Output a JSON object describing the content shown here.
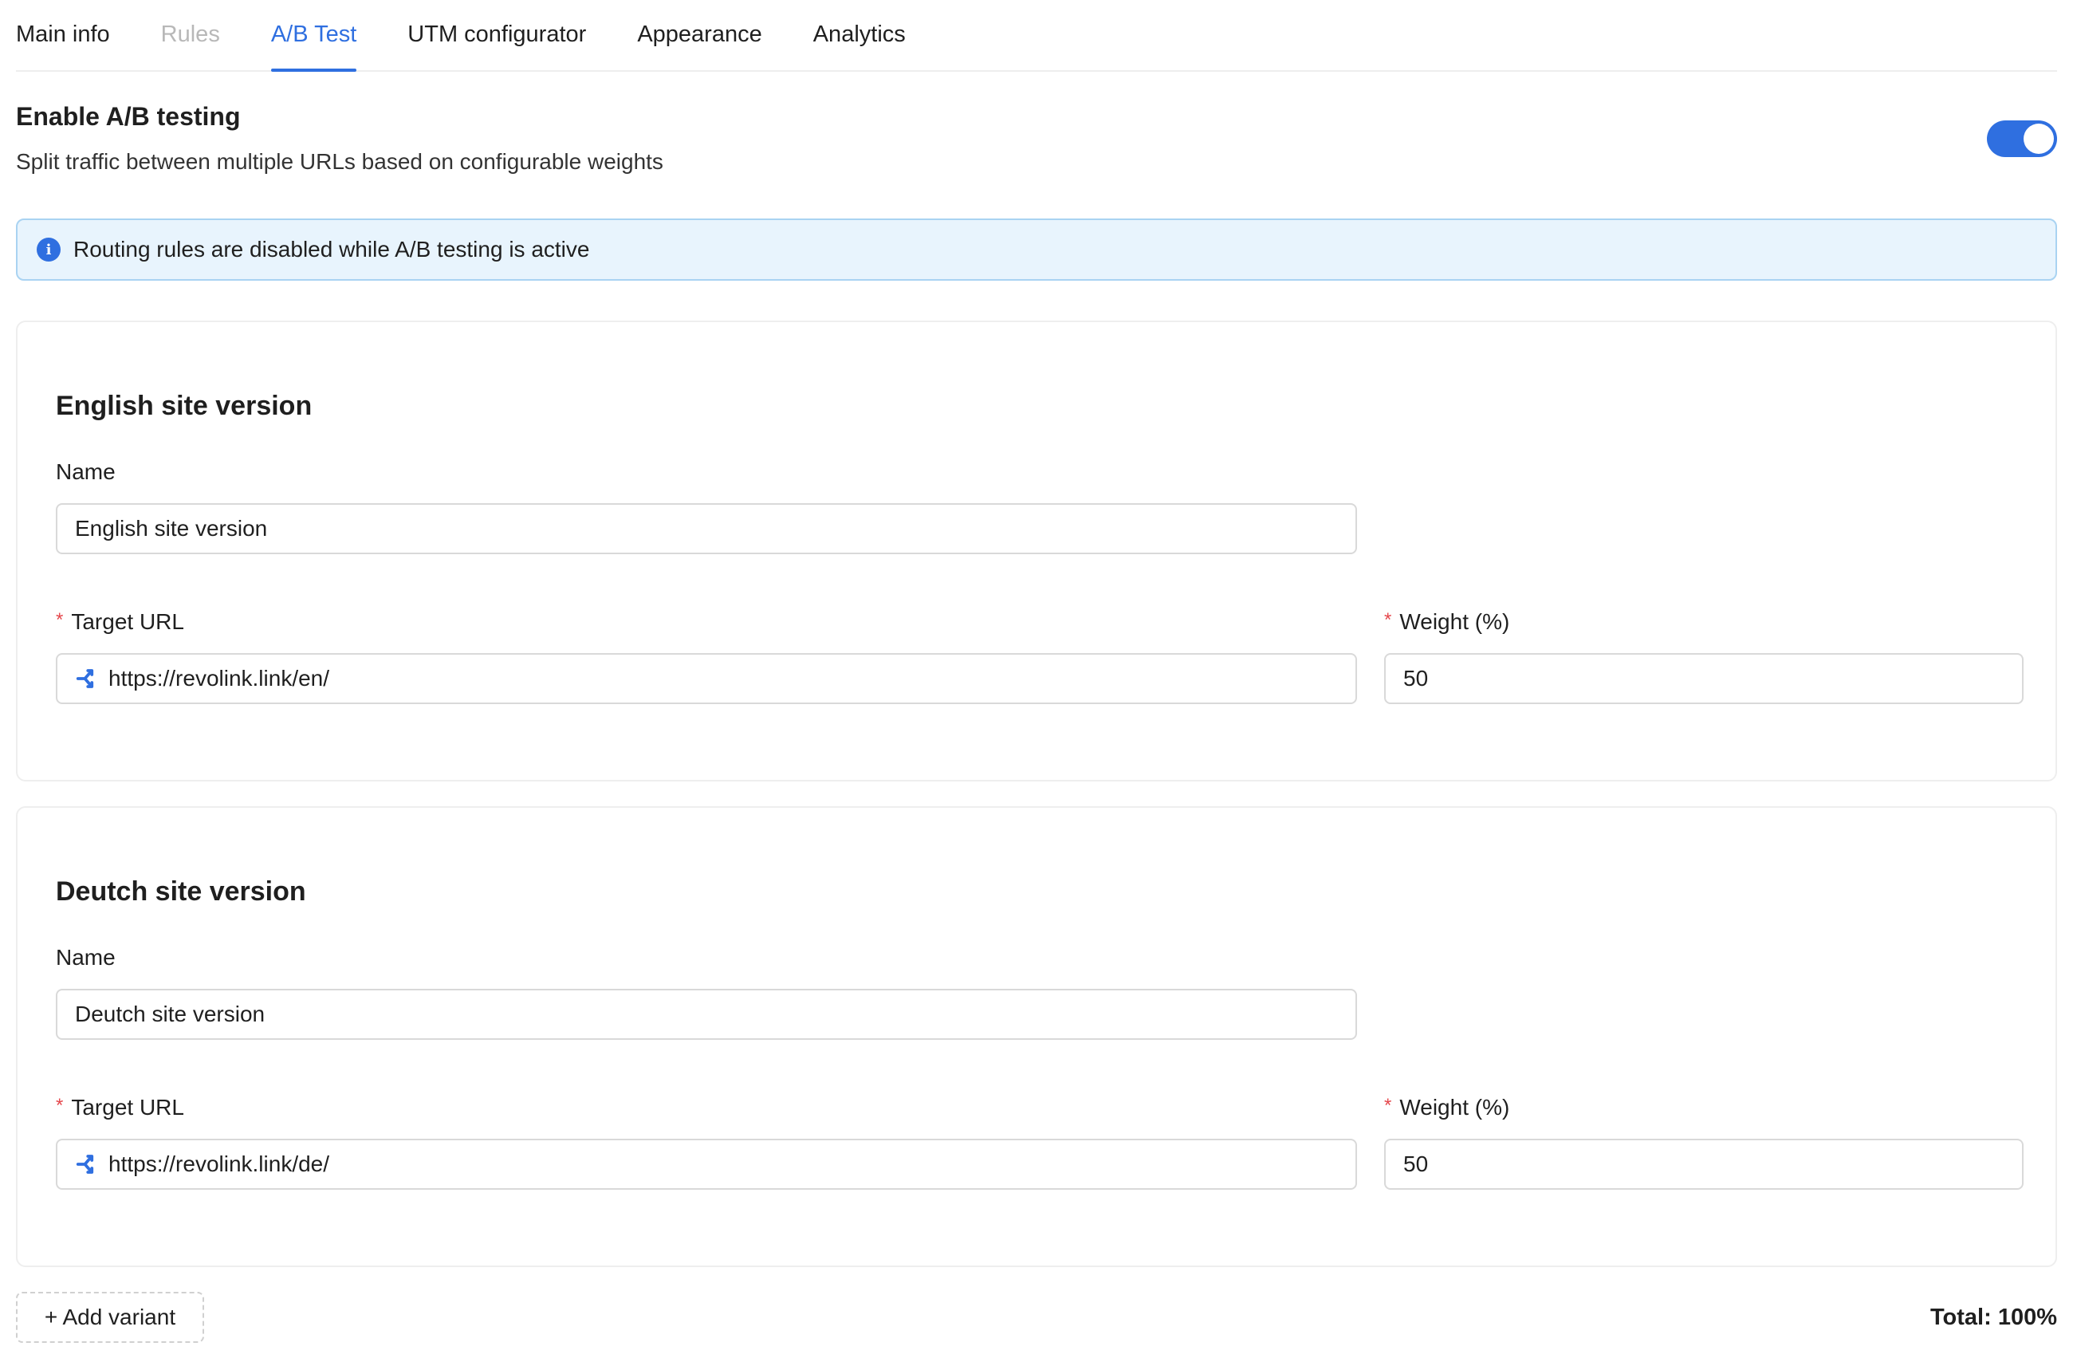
{
  "tabs": [
    {
      "label": "Main info",
      "state": "normal"
    },
    {
      "label": "Rules",
      "state": "disabled"
    },
    {
      "label": "A/B Test",
      "state": "active"
    },
    {
      "label": "UTM configurator",
      "state": "normal"
    },
    {
      "label": "Appearance",
      "state": "normal"
    },
    {
      "label": "Analytics",
      "state": "normal"
    }
  ],
  "ab_testing": {
    "title": "Enable A/B testing",
    "description": "Split traffic between multiple URLs based on configurable weights",
    "enabled": true
  },
  "alert": {
    "icon": "info-icon",
    "text": "Routing rules are disabled while A/B testing is active"
  },
  "variants": [
    {
      "title": "English site version",
      "name_label": "Name",
      "name_value": "English site version",
      "url_label": "Target URL",
      "url_value": "https://revolink.link/en/",
      "weight_label": "Weight (%)",
      "weight_value": "50"
    },
    {
      "title": "Deutch site version",
      "name_label": "Name",
      "name_value": "Deutch site version",
      "url_label": "Target URL",
      "url_value": "https://revolink.link/de/",
      "weight_label": "Weight (%)",
      "weight_value": "50"
    }
  ],
  "footer": {
    "add_variant_label": "+ Add variant",
    "total_label": "Total: 100%"
  },
  "colors": {
    "accent": "#2f6fe0",
    "alert_bg": "#e8f4fd",
    "alert_border": "#a9d3f2",
    "required": "#e5484d"
  }
}
